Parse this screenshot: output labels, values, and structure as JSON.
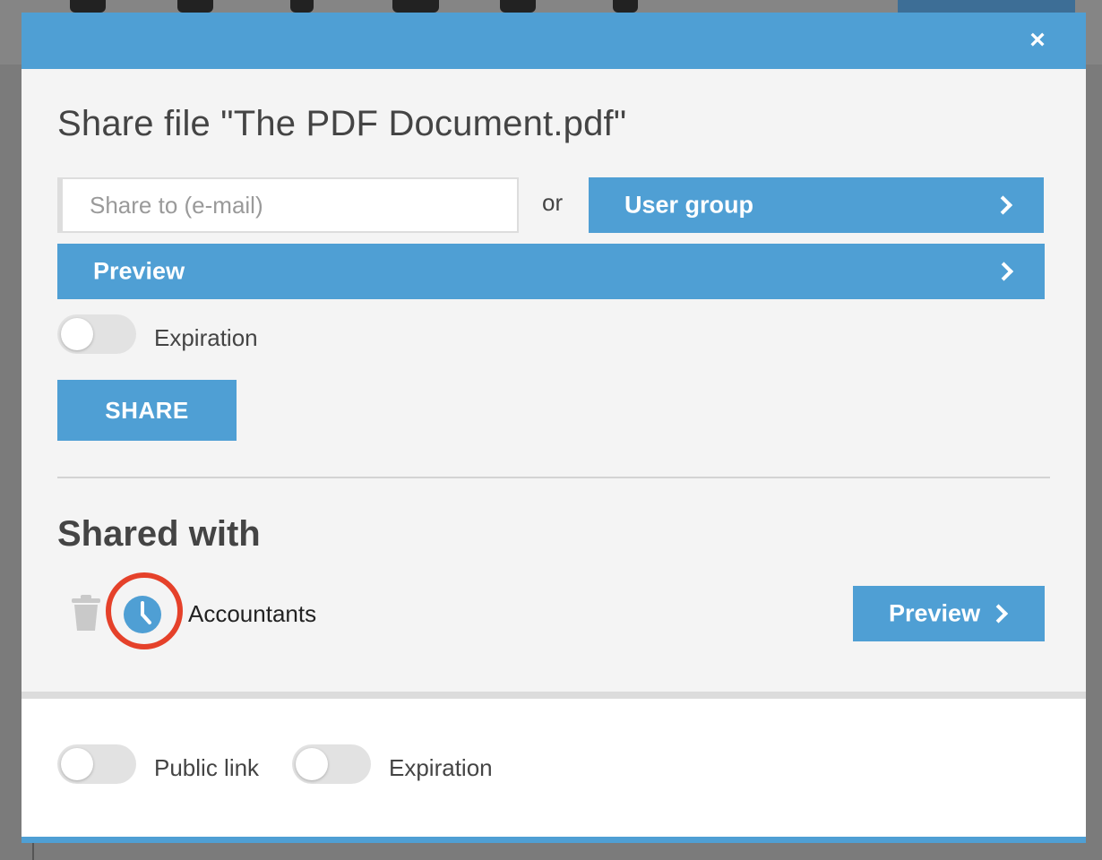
{
  "modal": {
    "close_symbol": "×",
    "title": "Share file \"The PDF Document.pdf\"",
    "email_input": {
      "placeholder": "Share to (e-mail)",
      "value": ""
    },
    "or_label": "or",
    "user_group_button": "User group",
    "preview_button": "Preview",
    "expiration_toggle": {
      "label": "Expiration",
      "on": false
    },
    "share_button": "SHARE",
    "shared_with": {
      "heading": "Shared with",
      "entries": [
        {
          "name": "Accountants",
          "icons": [
            "trash-icon",
            "clock-icon"
          ],
          "highlighted_icon": "clock-icon",
          "preview_button": "Preview"
        }
      ]
    },
    "footer": {
      "public_link_toggle": {
        "label": "Public link",
        "on": false
      },
      "expiration_toggle": {
        "label": "Expiration",
        "on": false
      }
    }
  },
  "colors": {
    "accent": "#4f9fd4",
    "highlight_ring": "#e5412a",
    "overlay_background": "#7d7d7d"
  }
}
